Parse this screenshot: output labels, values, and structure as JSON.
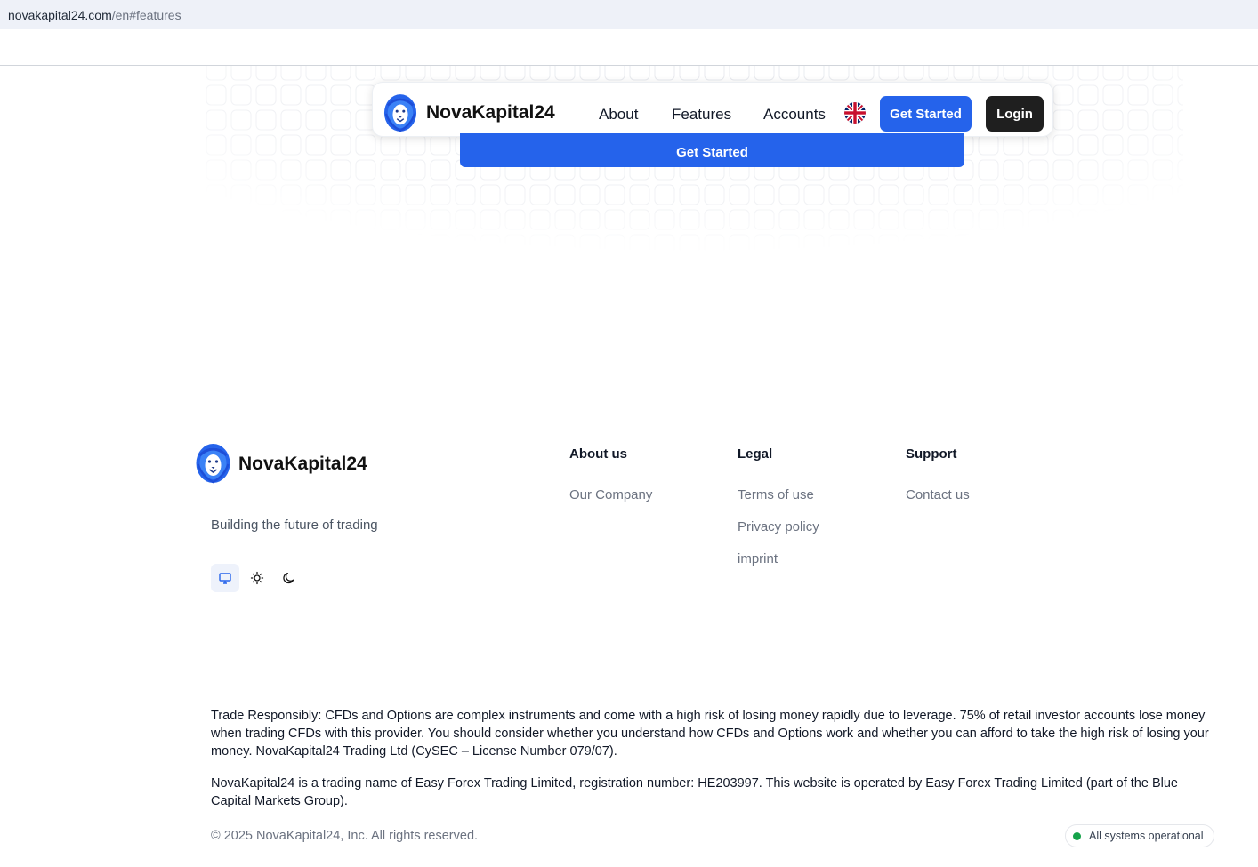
{
  "browser": {
    "url_domain": "novakapital24.com",
    "url_path": "/en#features"
  },
  "nav": {
    "brand": "NovaKapital24",
    "links": [
      "About",
      "Features",
      "Accounts"
    ],
    "get_started": "Get Started",
    "login": "Login",
    "flag_icon": "uk-flag-icon"
  },
  "hero": {
    "get_started": "Get Started"
  },
  "footer": {
    "brand": "NovaKapital24",
    "tagline": "Building the future of trading",
    "theme_icons": [
      "monitor-icon",
      "sun-icon",
      "moon-icon"
    ],
    "columns": [
      {
        "title": "About us",
        "links": [
          "Our Company"
        ]
      },
      {
        "title": "Legal",
        "links": [
          "Terms of use",
          "Privacy policy",
          "imprint"
        ]
      },
      {
        "title": "Support",
        "links": [
          "Contact us"
        ]
      }
    ],
    "disclaimer_1": "Trade Responsibly: CFDs and Options are complex instruments and come with a high risk of losing money rapidly due to leverage. 75% of retail investor accounts lose money when trading CFDs with this provider. You should consider whether you understand how CFDs and Options work and whether you can afford to take the high risk of losing your money. NovaKapital24 Trading Ltd (CySEC – License Number 079/07).",
    "disclaimer_2": "NovaKapital24 is a trading name of Easy Forex Trading Limited, registration number: HE203997. This website is operated by Easy Forex Trading Limited (part of the Blue Capital Markets Group).",
    "copyright": "© 2025 NovaKapital24, Inc. All rights reserved.",
    "status": "All systems operational"
  },
  "colors": {
    "primary": "#2563eb",
    "dark_button": "#1f1f1f",
    "status_green": "#16a34a"
  }
}
